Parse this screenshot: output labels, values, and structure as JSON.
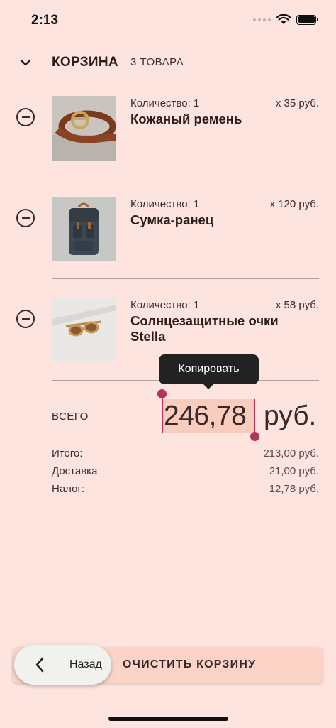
{
  "status_bar": {
    "time": "2:13"
  },
  "header": {
    "title": "КОРЗИНА",
    "count": "3 ТОВАРА"
  },
  "items": [
    {
      "quantity": "Количество: 1",
      "price": "x 35 руб.",
      "name": "Кожаный ремень",
      "image": "belt-image"
    },
    {
      "quantity": "Количество: 1",
      "price": "x 120 руб.",
      "name": "Сумка-ранец",
      "image": "backpack-image"
    },
    {
      "quantity": "Количество: 1",
      "price": "x 58 руб.",
      "name": "Солнцезащитные очки Stella",
      "image": "sunglasses-image"
    }
  ],
  "total": {
    "label": "ВСЕГО",
    "amount": "246,78",
    "currency": "руб."
  },
  "tooltip": {
    "label": "Копировать"
  },
  "summary": [
    {
      "label": "Итого:",
      "value": "213,00 руб."
    },
    {
      "label": "Доставка:",
      "value": "21,00 руб."
    },
    {
      "label": "Налог:",
      "value": "12,78 руб."
    }
  ],
  "buttons": {
    "clear": "ОЧИСТИТЬ КОРЗИНУ",
    "back": "Назад"
  },
  "colors": {
    "background": "#fde4df",
    "accent": "#b4355c",
    "selection": "#f9cdbe",
    "button": "#fbd3c7"
  }
}
